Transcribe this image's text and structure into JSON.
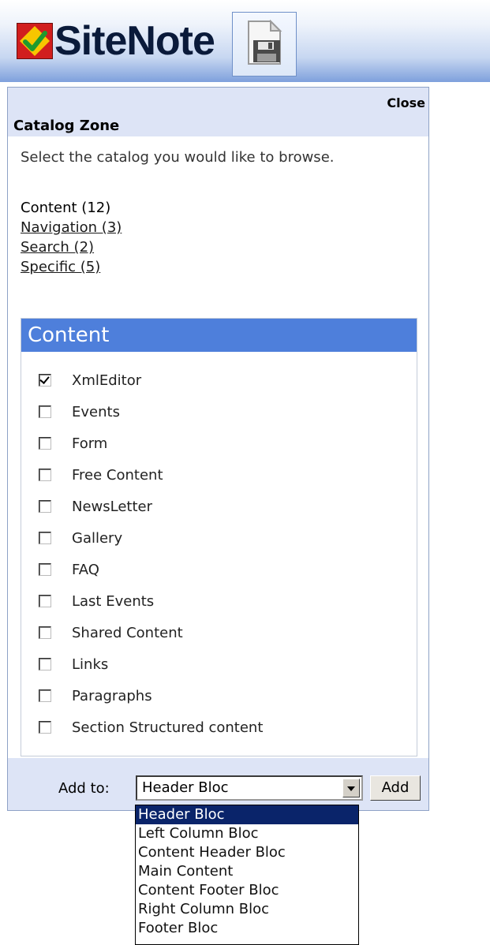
{
  "header": {
    "logo_text": "SiteNote",
    "logo_icon": "sitenote-check-logo",
    "save_icon": "floppy-save-icon",
    "accent_color": "#7ea0dc"
  },
  "catalog_zone": {
    "close_label": "Close",
    "title": "Catalog Zone",
    "instructions": "Select the catalog you would like to browse.",
    "catalogs": [
      {
        "label": "Content (12)",
        "current": true
      },
      {
        "label": "Navigation (3)",
        "current": false
      },
      {
        "label": "Search (2)",
        "current": false
      },
      {
        "label": "Specific (5)",
        "current": false
      }
    ]
  },
  "content": {
    "title": "Content",
    "title_color": "#4e7fdb",
    "items": [
      {
        "label": "XmlEditor",
        "checked": true
      },
      {
        "label": "Events",
        "checked": false
      },
      {
        "label": "Form",
        "checked": false
      },
      {
        "label": "Free Content",
        "checked": false
      },
      {
        "label": "NewsLetter",
        "checked": false
      },
      {
        "label": "Gallery",
        "checked": false
      },
      {
        "label": "FAQ",
        "checked": false
      },
      {
        "label": "Last Events",
        "checked": false
      },
      {
        "label": "Shared Content",
        "checked": false
      },
      {
        "label": "Links",
        "checked": false
      },
      {
        "label": "Paragraphs",
        "checked": false
      },
      {
        "label": "Section Structured content",
        "checked": false
      }
    ]
  },
  "footer": {
    "add_to_label": "Add to:",
    "selected_zone": "Header Bloc",
    "add_button": "Add",
    "options": [
      "Header Bloc",
      "Left Column Bloc",
      "Content Header Bloc",
      "Main Content",
      "Content Footer Bloc",
      "Right Column Bloc",
      "Footer Bloc"
    ]
  }
}
